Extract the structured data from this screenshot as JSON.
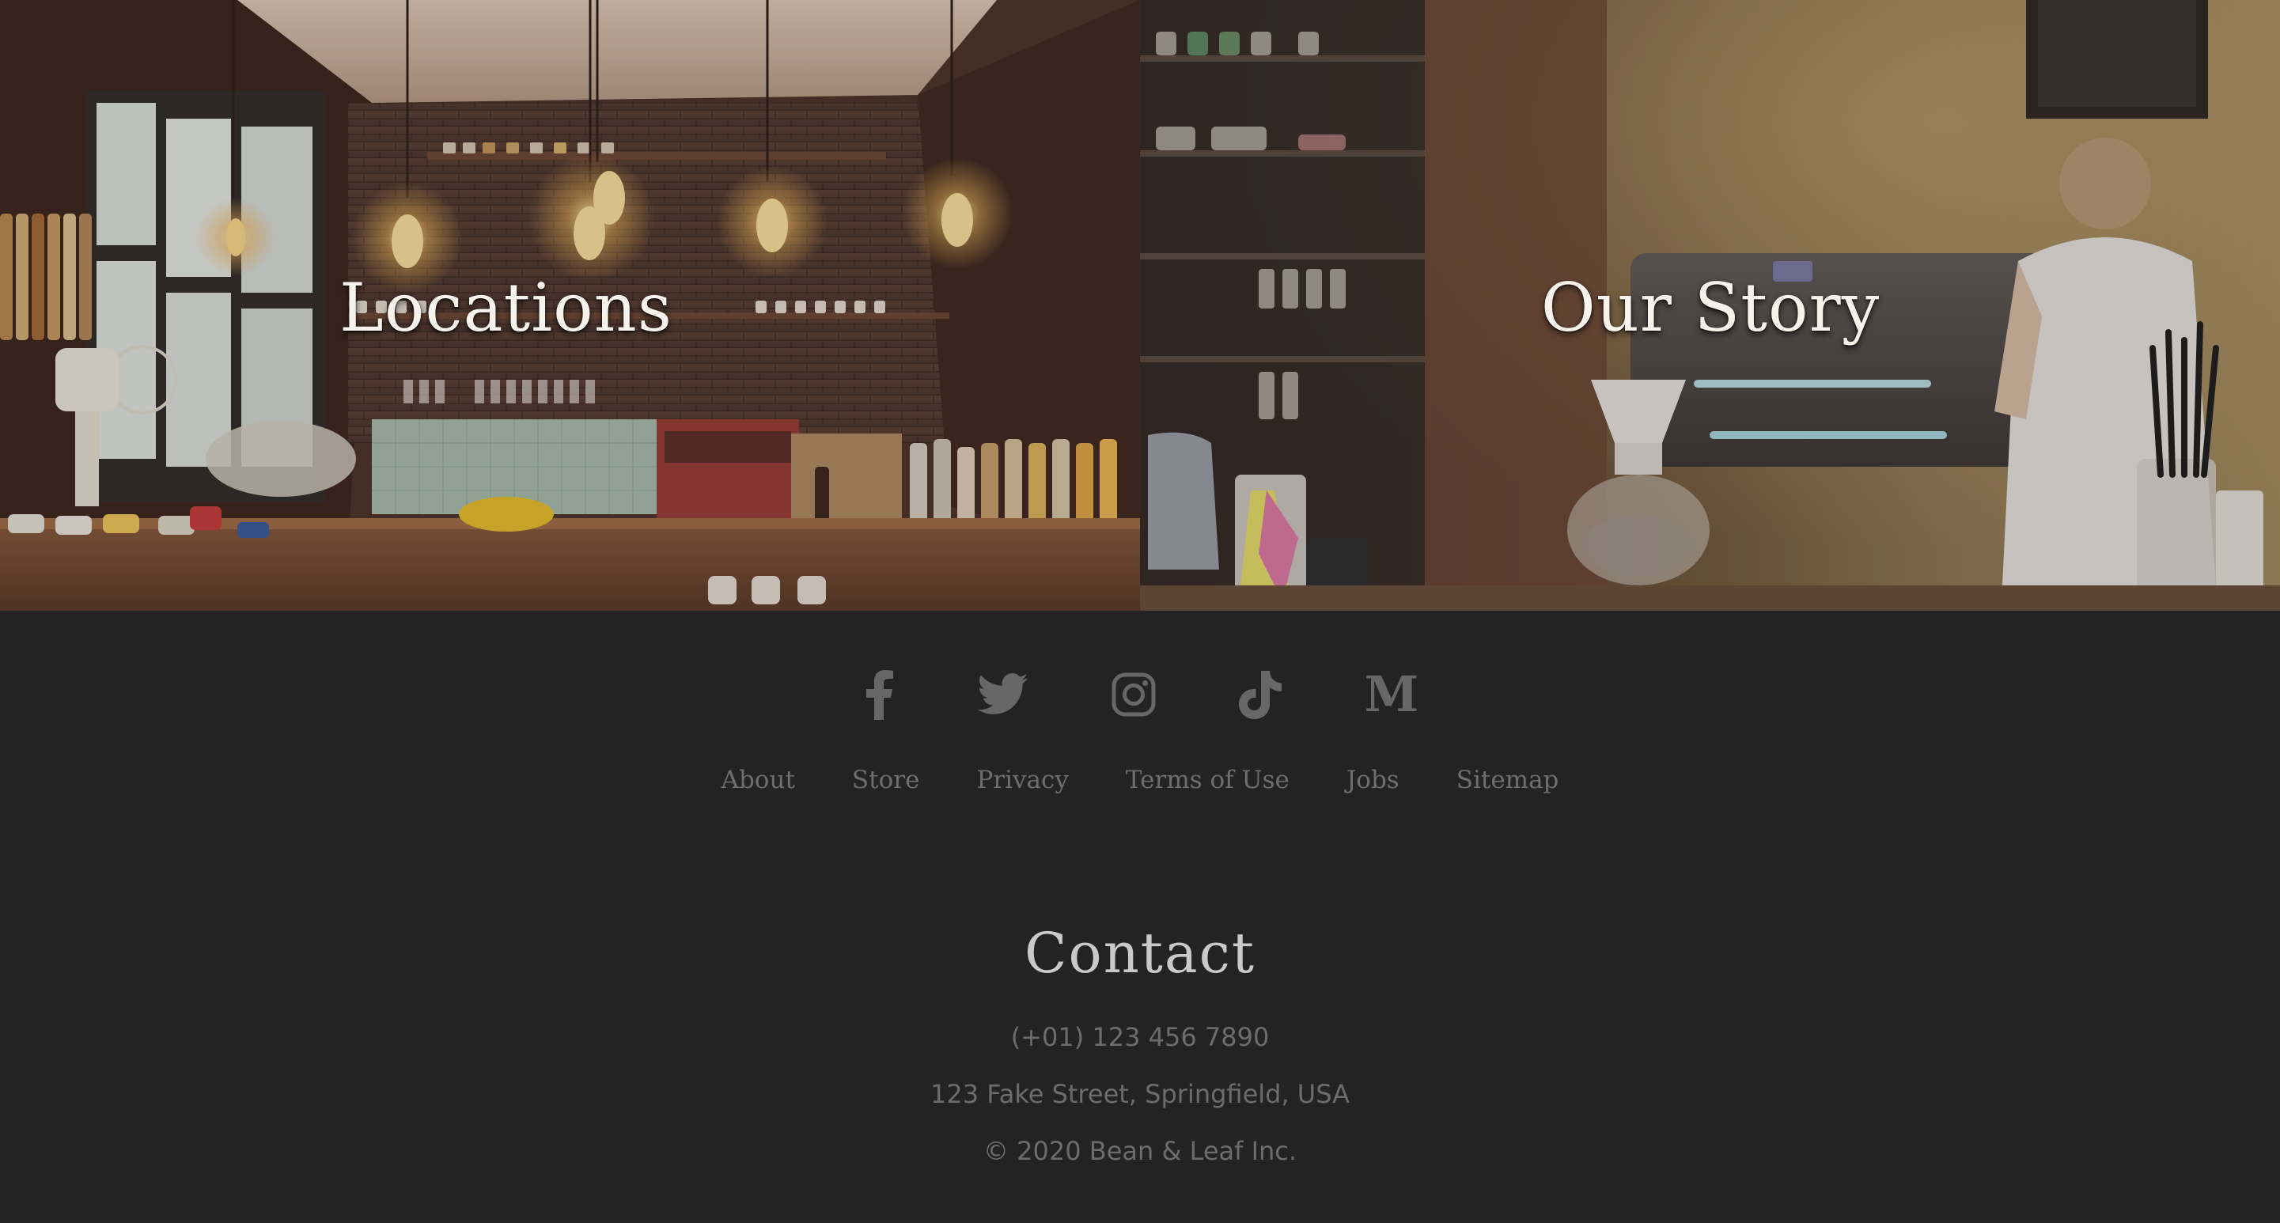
{
  "tiles": {
    "locations": {
      "title": "Locations"
    },
    "story": {
      "title": "Our Story"
    }
  },
  "footer": {
    "social": [
      {
        "name": "facebook",
        "icon": "facebook-icon"
      },
      {
        "name": "twitter",
        "icon": "twitter-icon"
      },
      {
        "name": "instagram",
        "icon": "instagram-icon"
      },
      {
        "name": "tiktok",
        "icon": "tiktok-icon"
      },
      {
        "name": "medium",
        "icon": "medium-icon",
        "glyph": "M"
      }
    ],
    "nav": {
      "about": "About",
      "store": "Store",
      "privacy": "Privacy",
      "terms": "Terms of Use",
      "jobs": "Jobs",
      "sitemap": "Sitemap"
    },
    "contact": {
      "title": "Contact",
      "phone": "(+01) 123 456 7890",
      "address": "123 Fake Street, Springfield, USA",
      "copyright": "© 2020 Bean & Leaf Inc."
    }
  },
  "colors": {
    "footer_bg": "#232323",
    "icon_gray": "#676767",
    "link_gray": "#6e6e6e",
    "heading_light": "#c9c9c9"
  }
}
